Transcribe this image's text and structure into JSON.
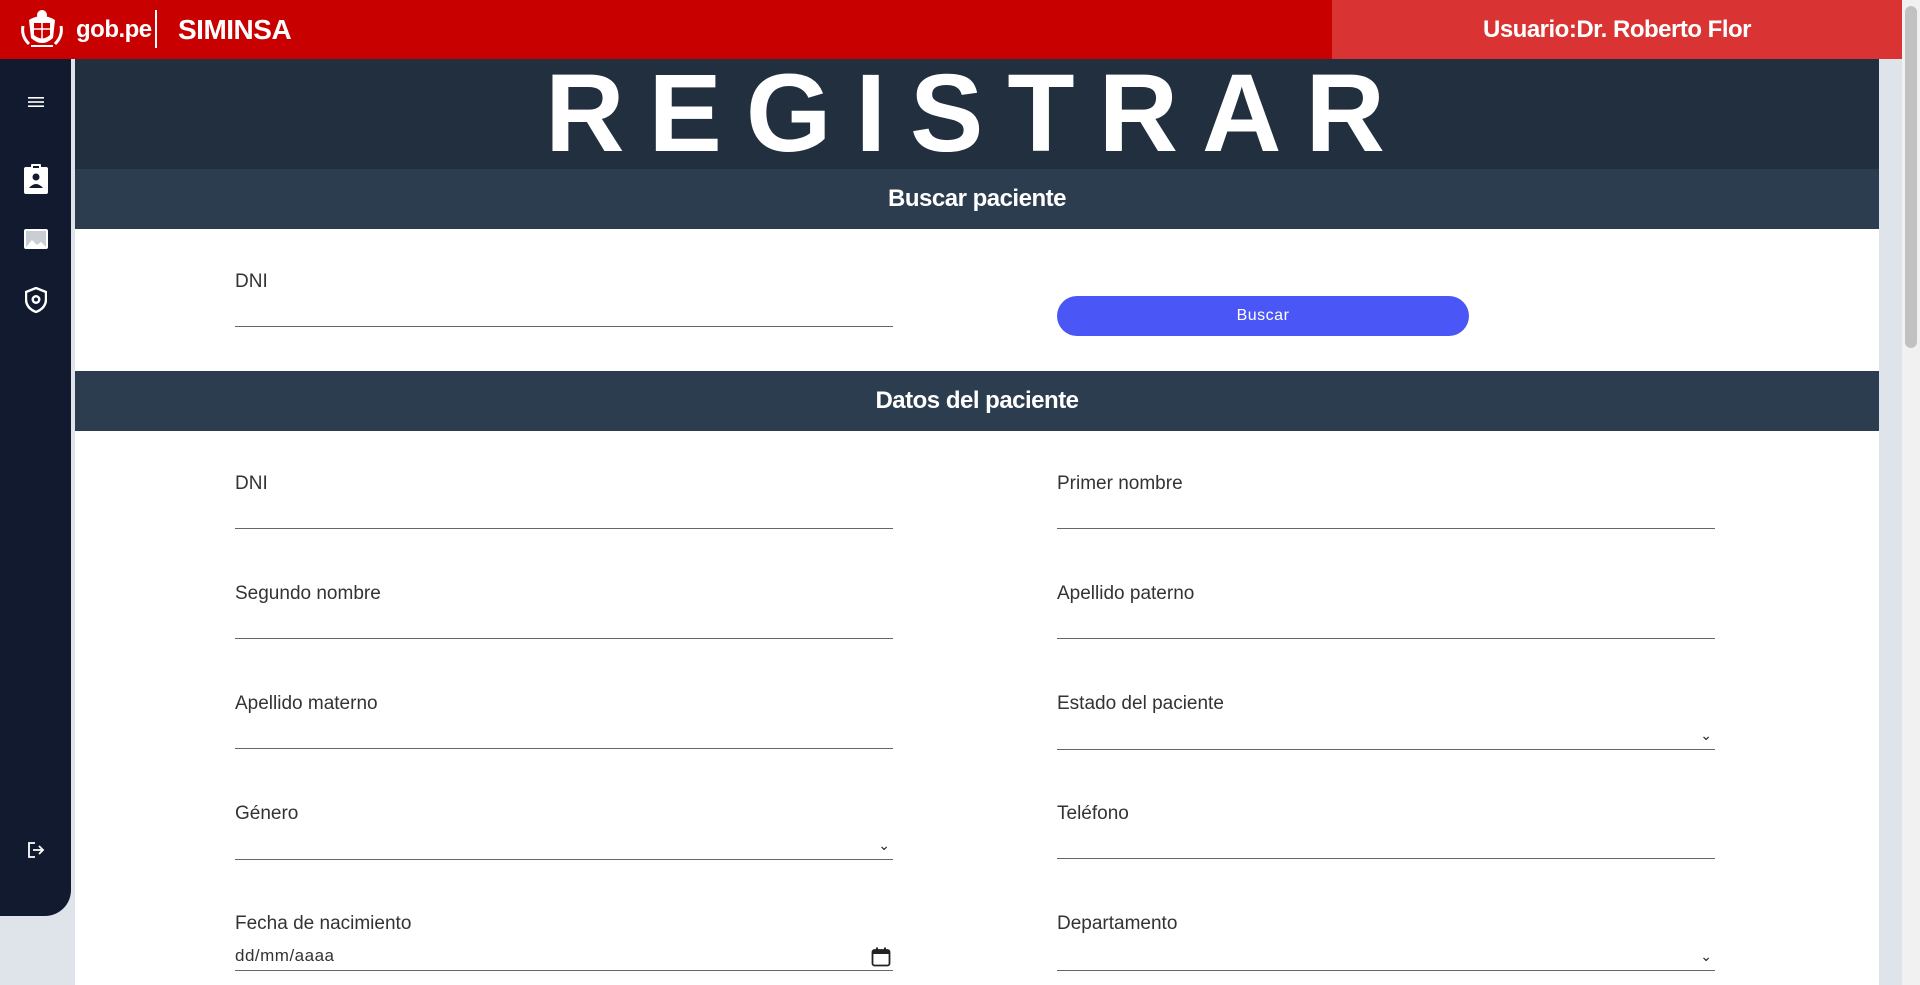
{
  "header": {
    "portal": "gob.pe",
    "app_name": "SIMINSA",
    "user_label": "Usuario:Dr. Roberto Flor"
  },
  "sidebar": {
    "icons": [
      "menu-icon",
      "patient-badge-icon",
      "image-icon",
      "shield-icon",
      "logout-icon"
    ]
  },
  "page": {
    "hero_title": "REGISTRAR"
  },
  "search": {
    "section_title": "Buscar paciente",
    "dni_label": "DNI",
    "button_label": "Buscar"
  },
  "patient": {
    "section_title": "Datos del paciente",
    "fields": {
      "dni": "DNI",
      "primer_nombre": "Primer nombre",
      "segundo_nombre": "Segundo nombre",
      "apellido_paterno": "Apellido paterno",
      "apellido_materno": "Apellido materno",
      "estado": "Estado del paciente",
      "genero": "Género",
      "telefono": "Teléfono",
      "fecha_nacimiento": "Fecha de nacimiento",
      "fecha_placeholder": "dd/mm/aaaa",
      "departamento": "Departamento"
    }
  },
  "colors": {
    "header_red": "#c80000",
    "user_panel": "#d93333",
    "sidebar": "#111a2e",
    "hero_bg": "#212f3e",
    "section_bg": "#2c3d50",
    "button_blue": "#4a56f5"
  }
}
